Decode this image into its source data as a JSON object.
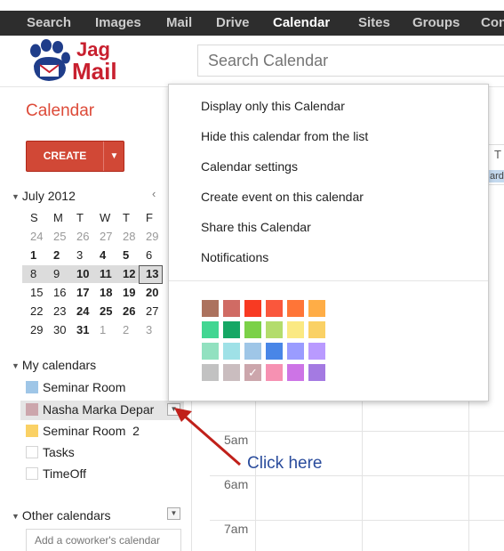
{
  "topnav": {
    "items": [
      "Search",
      "Images",
      "Mail",
      "Drive",
      "Calendar",
      "Sites",
      "Groups",
      "Con"
    ],
    "active": "Calendar"
  },
  "logo": {
    "line1": "Jag",
    "line2": "Mail"
  },
  "search": {
    "placeholder": "Search Calendar"
  },
  "app_title": "Calendar",
  "create": {
    "label": "CREATE",
    "arrow": "▼"
  },
  "mini_calendar": {
    "month": "July 2012",
    "prev": "‹",
    "weekdays": [
      "S",
      "M",
      "T",
      "W",
      "T",
      "F"
    ],
    "weeks": [
      [
        "24",
        "25",
        "26",
        "27",
        "28",
        "29"
      ],
      [
        "1",
        "2",
        "3",
        "4",
        "5",
        "6"
      ],
      [
        "8",
        "9",
        "10",
        "11",
        "12",
        "13"
      ],
      [
        "15",
        "16",
        "17",
        "18",
        "19",
        "20"
      ],
      [
        "22",
        "23",
        "24",
        "25",
        "26",
        "27"
      ],
      [
        "29",
        "30",
        "31",
        "1",
        "2",
        "3"
      ]
    ],
    "today": "13"
  },
  "my_calendars": {
    "heading": "My calendars",
    "items": [
      {
        "label": "Seminar Room",
        "color": "#9fc6e7"
      },
      {
        "label": "Nasha Marka Depar",
        "color": "#cca6ac"
      },
      {
        "label": "Seminar Room  2",
        "color": "#fad165"
      },
      {
        "label": "Tasks",
        "color": ""
      },
      {
        "label": "TimeOff",
        "color": ""
      }
    ]
  },
  "other_calendars": {
    "heading": "Other calendars",
    "add_placeholder": "Add a coworker's calendar"
  },
  "grid": {
    "hours": [
      "5am",
      "6am",
      "7am"
    ],
    "column_header": "T",
    "event_snippet": "ard"
  },
  "popup_menu": {
    "items": [
      "Display only this Calendar",
      "Hide this calendar from the list",
      "Calendar settings",
      "Create event on this calendar",
      "Share this Calendar",
      "Notifications"
    ],
    "swatches": [
      [
        "#ac725e",
        "#d06b64",
        "#f83a22",
        "#fa573c",
        "#ff7537",
        "#ffad46"
      ],
      [
        "#42d692",
        "#16a765",
        "#7bd148",
        "#b3dc6c",
        "#fbe983",
        "#fad165"
      ],
      [
        "#92e1c0",
        "#9fe1e7",
        "#9fc6e7",
        "#4986e7",
        "#9a9cff",
        "#b99aff"
      ],
      [
        "#c2c2c2",
        "#cabdbf",
        "#cca6ac",
        "#f691b2",
        "#cd74e6",
        "#a47ae2"
      ]
    ],
    "selected_mark": "✓"
  },
  "annotation": {
    "text": "Click here"
  }
}
